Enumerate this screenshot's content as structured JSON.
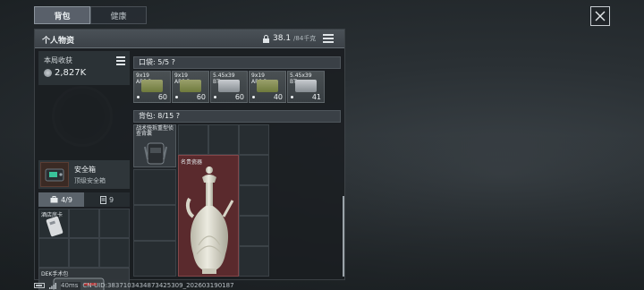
{
  "tabs": [
    {
      "label": "背包",
      "active": true
    },
    {
      "label": "健康",
      "active": false
    }
  ],
  "panel": {
    "title": "个人物资",
    "weight_value": "38.1",
    "weight_max": "/84千克"
  },
  "earnings": {
    "label": "本局收获",
    "value": "2,827K"
  },
  "safe_box": {
    "title": "安全箱",
    "subtitle": "顶级安全箱"
  },
  "sub_tabs": [
    {
      "label": "4/9",
      "icon": "briefcase-icon",
      "active": true
    },
    {
      "label": "9",
      "icon": "document-icon",
      "active": false
    }
  ],
  "left_items": [
    {
      "label": "酒店房卡"
    },
    {
      "label": "DEK手术包",
      "count": "?/?"
    }
  ],
  "pocket": {
    "label": "口袋: 5/5 ?",
    "slots": [
      {
        "name_line1": "9x19",
        "name_line2": "AP6.3",
        "count": "60",
        "color": "green"
      },
      {
        "name_line1": "9x19",
        "name_line2": "AP6.3",
        "count": "60",
        "color": "green"
      },
      {
        "name_line1": "5.45x39",
        "name_line2": "BT",
        "count": "60",
        "color": "silver"
      },
      {
        "name_line1": "9x19",
        "name_line2": "AP6.3",
        "count": "40",
        "color": "green"
      },
      {
        "name_line1": "5.45x39",
        "name_line2": "BT",
        "count": "41",
        "color": "silver"
      }
    ]
  },
  "backpack": {
    "label": "背包: 8/15 ?",
    "rig_label": "战术快拆重型侦查背囊",
    "vase_label": "名贵瓷器"
  },
  "footer": {
    "ping": "40ms",
    "uid": "CN-UID:3837103434873425309_202603190187"
  },
  "colors": {
    "vase_cell_bg": "#5a2a2d",
    "tab_active": "#59606a"
  }
}
